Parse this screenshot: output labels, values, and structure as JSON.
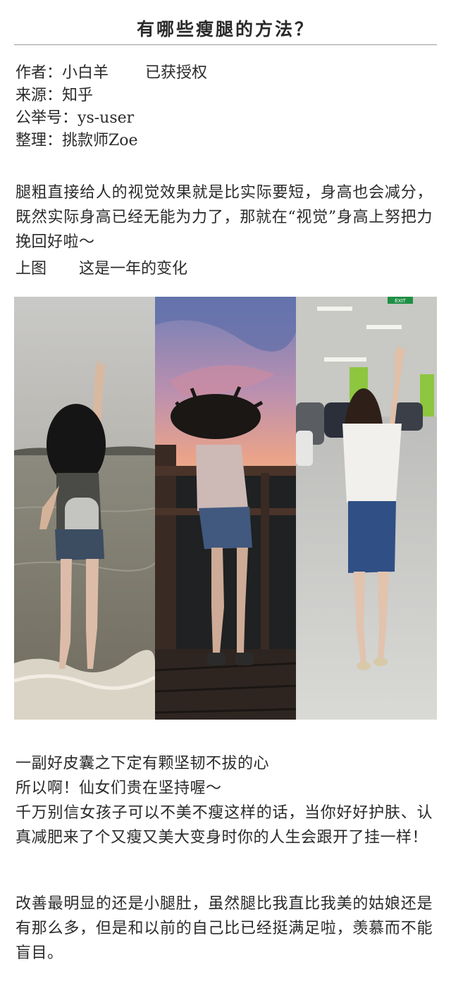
{
  "article": {
    "title": "有哪些瘦腿的方法？",
    "author_label": "作者：",
    "author": "小白羊",
    "authorized": "已获授权",
    "source_label": "来源：",
    "source": "知乎",
    "account_label": "公举号：",
    "account": "ys-user",
    "editor_label": "整理：",
    "editor": "挑款师Zoe",
    "intro": "腿粗直接给人的视觉效果就是比实际要短，身高也会减分，既然实际身高已经无能为力了，那就在“视觉”身高上努把力挽回好啦～",
    "caption_left": "上图",
    "caption_right": "这是一年的变化",
    "paragraph2": "一副好皮囊之下定有颗坚韧不拔的心 所以啊！仙女们贵在坚持喔～ 千万别信女孩子可以不美不瘦这样的话，当你好好护肤、认真减肥来了个又瘦又美大变身时你的人生会跟开了挂一样！",
    "paragraph2_lines": [
      "一副好皮囊之下定有颗坚韧不拔的心",
      "所以啊！仙女们贵在坚持喔～",
      "千万别信女孩子可以不美不瘦这样的话，当你好好护肤、认真减肥来了个又瘦又美大变身时你的人生会跟开了挂一样！"
    ],
    "paragraph3": "改善最明显的还是小腿肚，虽然腿比我直比我美的姑娘还是有那么多，但是和以前的自己比已经挺满足啦，羡慕而不能盲目。"
  },
  "photos": {
    "sign_text": "EXIT"
  },
  "colors": {
    "text": "#2a2a2a",
    "rule": "#9a9a9a"
  }
}
